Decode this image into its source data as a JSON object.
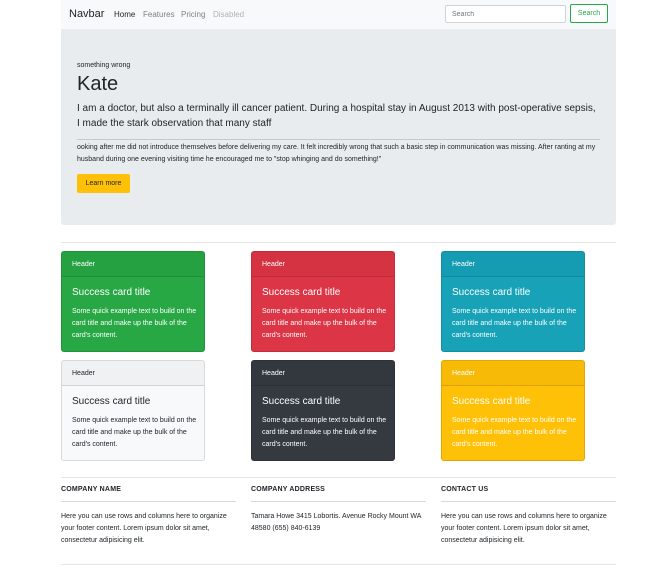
{
  "navbar": {
    "brand": "Navbar",
    "links": [
      {
        "label": "Home",
        "state": "active"
      },
      {
        "label": "Features",
        "state": "normal"
      },
      {
        "label": "Pricing",
        "state": "normal"
      },
      {
        "label": "Disabled",
        "state": "disabled"
      }
    ],
    "search_placeholder": "Search",
    "search_button": "Search"
  },
  "jumbotron": {
    "kicker": "something wrong",
    "title": "Kate",
    "lead": "I am a doctor, but also a terminally ill cancer patient. During a hospital stay in August 2013 with post-operative sepsis, I made the stark observation that many staff",
    "body": "ooking after me did not introduce themselves before delivering my care. It felt incredibly wrong that such a basic step in communication was missing. After ranting at my husband during one evening visiting time he encouraged me to \"stop whinging and do something!\"",
    "button": "Learn more"
  },
  "cards": [
    {
      "variant": "success",
      "header": "Header",
      "title": "Success card title",
      "text": "Some quick example text to build on the card title and make up the bulk of the card's content."
    },
    {
      "variant": "danger",
      "header": "Header",
      "title": "Success card title",
      "text": "Some quick example text to build on the card title and make up the bulk of the card's content."
    },
    {
      "variant": "info",
      "header": "Header",
      "title": "Success card title",
      "text": "Some quick example text to build on the card title and make up the bulk of the card's content."
    },
    {
      "variant": "light",
      "header": "Header",
      "title": "Success card title",
      "text": "Some quick example text to build on the card title and make up the bulk of the card's content."
    },
    {
      "variant": "dark",
      "header": "Header",
      "title": "Success card title",
      "text": "Some quick example text to build on the card title and make up the bulk of the card's content."
    },
    {
      "variant": "warning",
      "header": "Header",
      "title": "Success card title",
      "text": "Some quick example text to build on the card title and make up the bulk of the card's content."
    }
  ],
  "footer": {
    "columns": [
      {
        "heading": "COMPANY NAME",
        "text": "Here you can use rows and columns here to organize your footer content. Lorem ipsum dolor sit amet, consectetur adipisicing elit."
      },
      {
        "heading": "COMPANY ADDRESS",
        "text": "Tamara Howe 3415 Lobortis. Avenue Rocky Mount WA 48580 (655) 840-6139"
      },
      {
        "heading": "CONTACT US",
        "text": "Here you can use rows and columns here to organize your footer content. Lorem ipsum dolor sit amet, consectetur adipisicing elit."
      }
    ]
  },
  "colors": {
    "success": "#28a745",
    "danger": "#dc3545",
    "info": "#17a2b8",
    "light": "#f8f9fa",
    "dark": "#343a40",
    "warning": "#ffc107",
    "jumbotron_bg": "#e9ecef"
  }
}
